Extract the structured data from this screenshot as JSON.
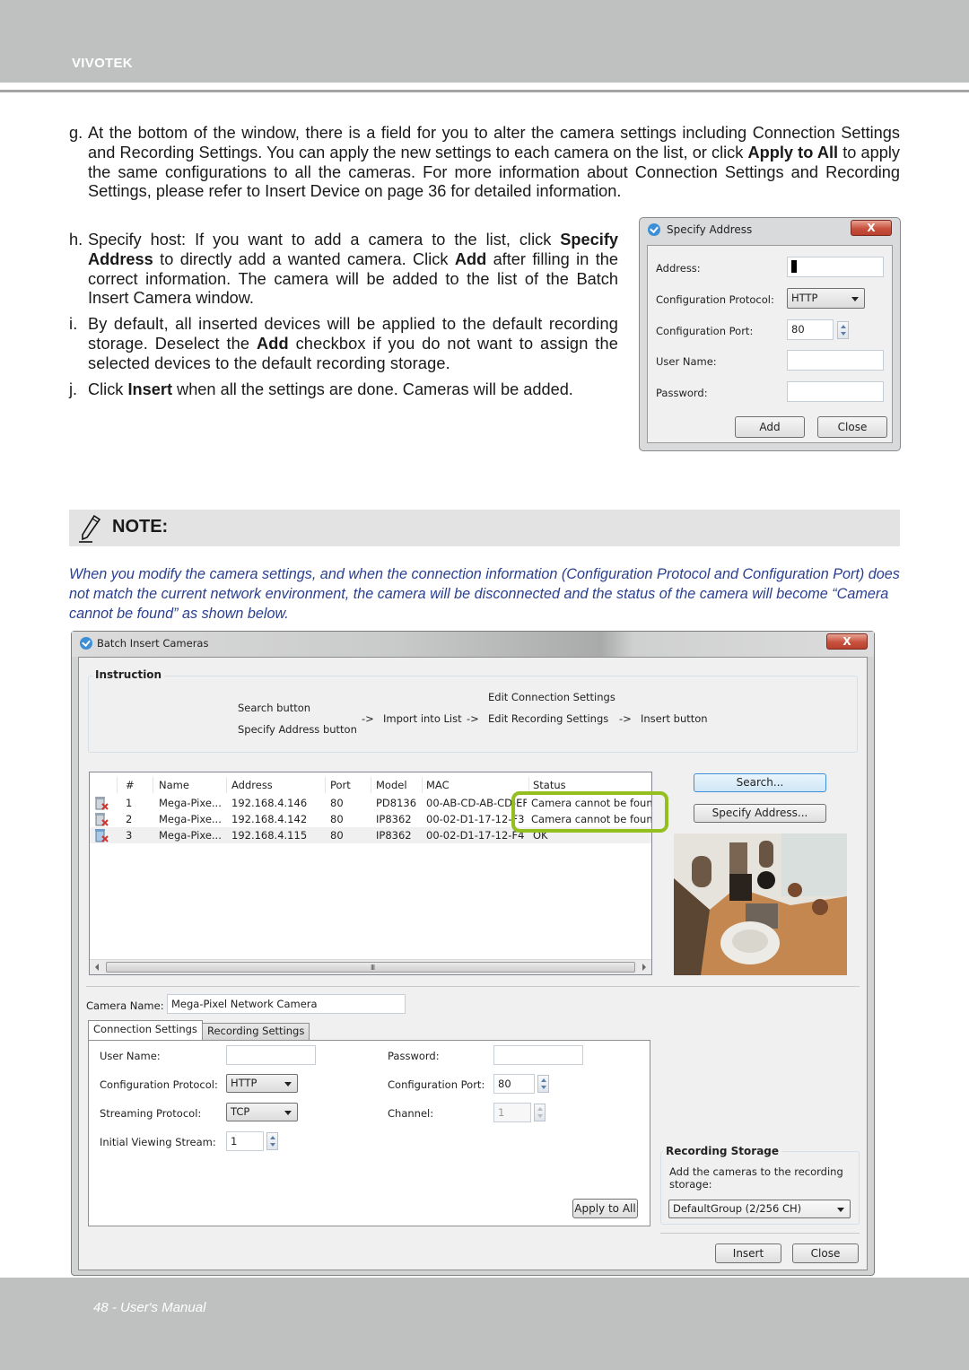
{
  "header": {
    "brand": "VIVOTEK"
  },
  "footer": {
    "page_label": "48 - User's Manual"
  },
  "steps": {
    "g": {
      "label": "g.",
      "text_1": "At the bottom of the window, there is a field for you to alter the camera settings including Connection Settings and Recording Settings. You can apply the new settings to each camera on the list, or click ",
      "bold_1": "Apply to All",
      "text_2": " to apply the same configurations to all the cameras. For more information about Connection Settings and Recording Settings, please refer to Insert Device on page 36 for detailed information."
    },
    "h": {
      "label": "h.",
      "text_1": "Specify host: If you want to add a camera to the list, click ",
      "bold_1": "Specify Address",
      "text_2": " to directly add a wanted camera. Click ",
      "bold_2": "Add",
      "text_3": " after filling in the correct information. The camera will be added to the list of the Batch Insert Camera window."
    },
    "i": {
      "label": "i.",
      "text_1": "By default, all inserted devices will be applied to the default recording storage. Deselect the ",
      "bold_1": "Add",
      "text_2": " checkbox if you do not want to assign the selected devices to the default recording storage."
    },
    "j": {
      "label": "j.",
      "text_1": "Click ",
      "bold_1": "Insert",
      "text_2": " when all the settings are done. Cameras will be added."
    }
  },
  "specify_dialog": {
    "title": "Specify Address",
    "close_glyph": "X",
    "address_label": "Address:",
    "address_value": "",
    "protocol_label": "Configuration Protocol:",
    "protocol_value": "HTTP",
    "port_label": "Configuration Port:",
    "port_value": "80",
    "username_label": "User Name:",
    "username_value": "",
    "password_label": "Password:",
    "password_value": "",
    "add_button": "Add",
    "close_button": "Close"
  },
  "note": {
    "title": "NOTE:",
    "body": "When you modify the camera settings, and when the connection information (Configuration Protocol and Configuration Port) does not match the current network environment, the camera will be disconnected and the status of the camera will become “Camera cannot be found” as shown below."
  },
  "batch_dialog": {
    "title": "Batch Insert Cameras",
    "close_glyph": "X",
    "instruction": {
      "title": "Instruction",
      "search_button": "Search button",
      "specify_button": "Specify Address button",
      "arrow_1": "->",
      "import": "Import into List",
      "arrow_2": "->",
      "edit_connection": "Edit Connection Settings",
      "edit_recording": "Edit Recording Settings",
      "arrow_3": "->",
      "insert": "Insert button"
    },
    "table": {
      "columns": [
        "#",
        "Name",
        "Address",
        "Port",
        "Model",
        "MAC",
        "Status"
      ],
      "rows": [
        {
          "num": "1",
          "name": "Mega-Pixe...",
          "address": "192.168.4.146",
          "port": "80",
          "model": "PD8136",
          "mac": "00-AB-CD-AB-CD-EF",
          "status": "Camera cannot be found."
        },
        {
          "num": "2",
          "name": "Mega-Pixe...",
          "address": "192.168.4.142",
          "port": "80",
          "model": "IP8362",
          "mac": "00-02-D1-17-12-F3",
          "status": "Camera cannot be found."
        },
        {
          "num": "3",
          "name": "Mega-Pixe...",
          "address": "192.168.4.115",
          "port": "80",
          "model": "IP8362",
          "mac": "00-02-D1-17-12-F4",
          "status": "OK"
        }
      ],
      "scroll_grip": "III"
    },
    "search_button": "Search...",
    "specify_button": "Specify Address...",
    "camera_name_label": "Camera Name:",
    "camera_name_value": "Mega-Pixel Network Camera",
    "tabs": [
      "Connection Settings",
      "Recording Settings"
    ],
    "connection": {
      "username_label": "User Name:",
      "username_value": "",
      "password_label": "Password:",
      "password_value": "",
      "config_protocol_label": "Configuration Protocol:",
      "config_protocol_value": "HTTP",
      "config_port_label": "Configuration Port:",
      "config_port_value": "80",
      "streaming_protocol_label": "Streaming Protocol:",
      "streaming_protocol_value": "TCP",
      "channel_label": "Channel:",
      "channel_value": "1",
      "viewing_stream_label": "Initial Viewing Stream:",
      "viewing_stream_value": "1",
      "apply_all_button": "Apply to All"
    },
    "recording_storage": {
      "title": "Recording Storage",
      "description": "Add the cameras to the recording storage:",
      "group_value": "DefaultGroup (2/256 CH)"
    },
    "insert_button": "Insert",
    "close_button": "Close"
  },
  "colors": {
    "header_gray": "#bfc1c0",
    "note_text": "#2a3f8f",
    "highlight_green": "#93c01f"
  }
}
